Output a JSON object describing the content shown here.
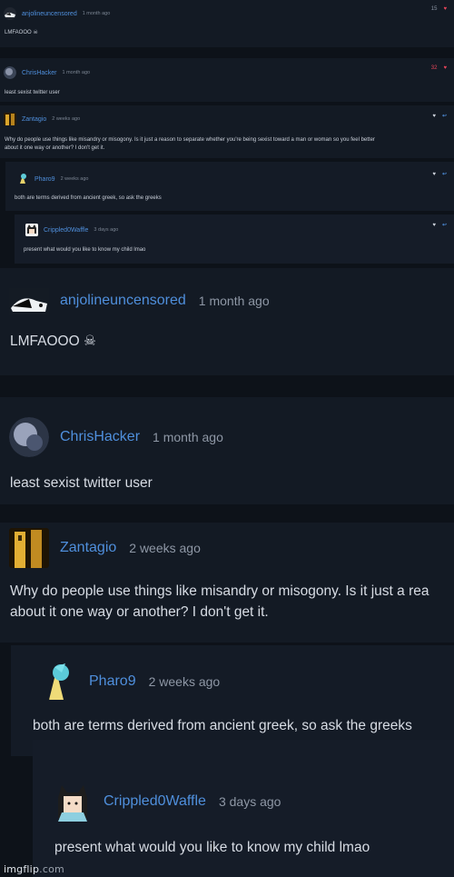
{
  "small": {
    "comments": [
      {
        "user": "anjolineuncensored",
        "time": "1 month ago",
        "text": "LMFAOOO ☠",
        "likes": "15"
      },
      {
        "user": "ChrisHacker",
        "time": "1 month ago",
        "text": "least sexist twitter user",
        "likes": "32"
      },
      {
        "user": "Zantagio",
        "time": "2 weeks ago",
        "text": "Why do people use things like misandry or misogony. Is it just a reason to separate whether you're being sexist toward a man or woman so you feel better",
        "text2": "about it one way or another? I don't get it."
      },
      {
        "user": "Pharo9",
        "time": "2 weeks ago",
        "text": "both are terms derived from ancient greek, so ask the greeks"
      },
      {
        "user": "Crippled0Waffle",
        "time": "3 days ago",
        "text": "present what would you like to know my child lmao"
      }
    ]
  },
  "large": {
    "comments": [
      {
        "user": "anjolineuncensored",
        "time": "1 month ago",
        "text": "LMFAOOO ☠"
      },
      {
        "user": "ChrisHacker",
        "time": "1 month ago",
        "text": "least sexist twitter user"
      },
      {
        "user": "Zantagio",
        "time": "2 weeks ago",
        "text": "Why do people use things like misandry or misogony. Is it just a rea",
        "text2": "about it one way or another? I don't get it."
      },
      {
        "user": "Pharo9",
        "time": "2 weeks ago",
        "text": "both are terms derived from ancient greek, so ask the greeks"
      },
      {
        "user": "Crippled0Waffle",
        "time": "3 days ago",
        "text": "present what would you like to know my child lmao"
      }
    ]
  },
  "watermark": {
    "bright": "imgflip",
    "dim": ".com"
  },
  "icons": {
    "like": "heart-icon",
    "reply": "reply-arrow-icon"
  },
  "colors": {
    "background": "#0d1219",
    "card": "#131a24",
    "username": "#4f8fdc",
    "like_active": "#e8455a"
  }
}
